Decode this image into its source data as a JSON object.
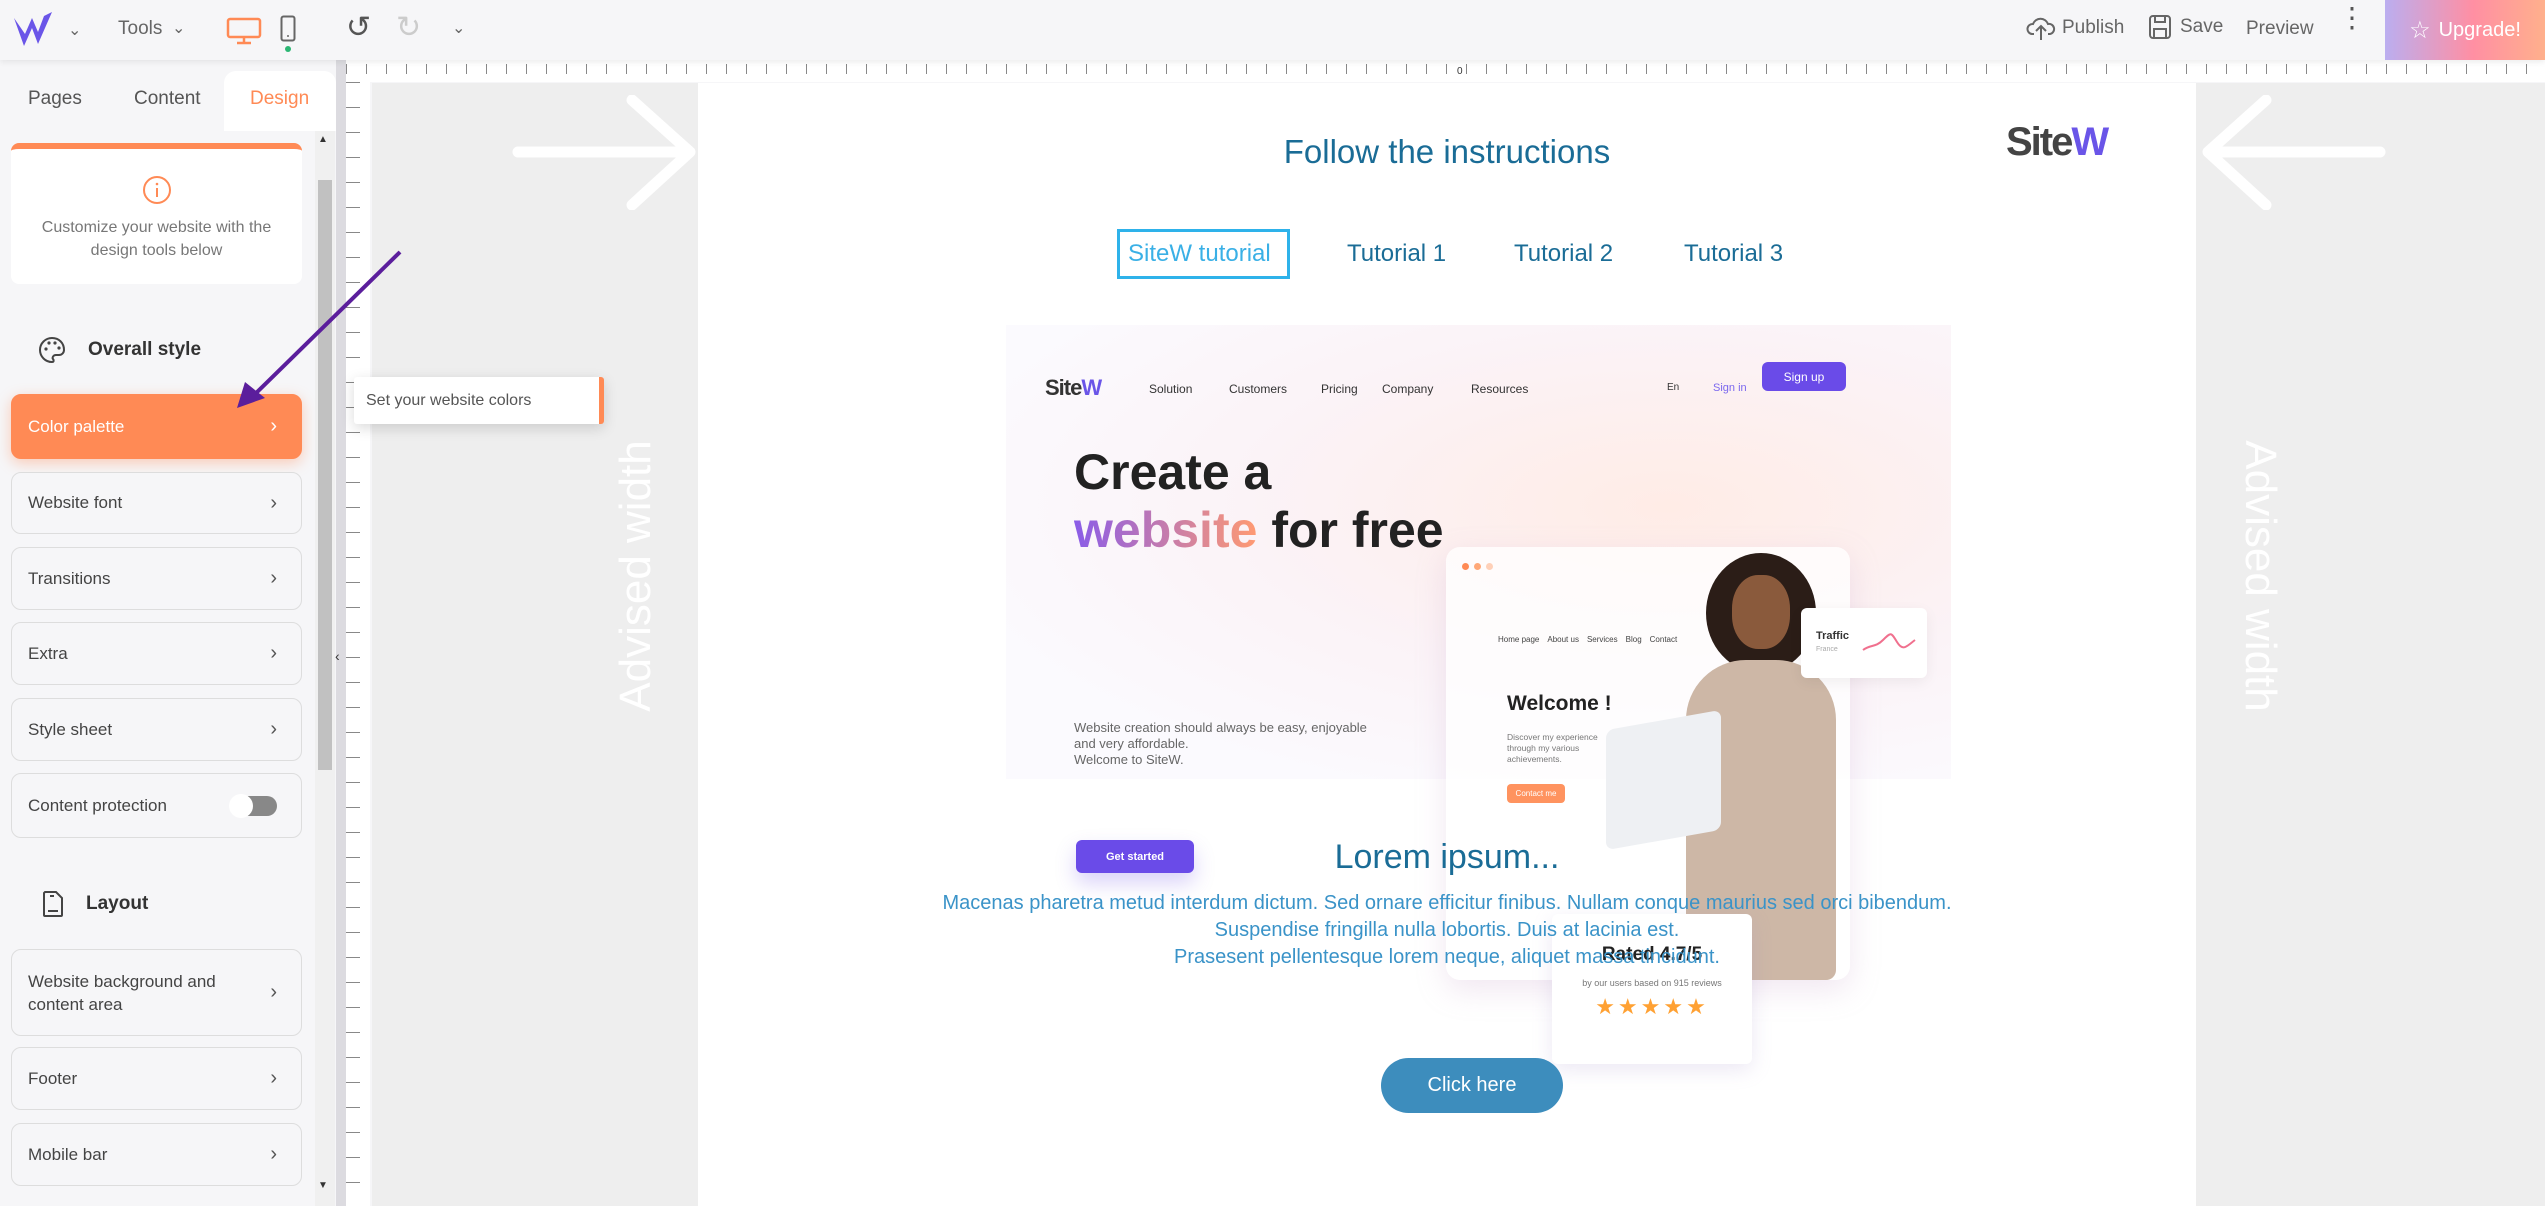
{
  "topbar": {
    "tools_label": "Tools",
    "publish_label": "Publish",
    "save_label": "Save",
    "preview_label": "Preview",
    "upgrade_label": "Upgrade!",
    "accent": "#ff8a55",
    "upgrade_gradient": [
      "#bbaef0",
      "#ff8fa3",
      "#ffb08c"
    ]
  },
  "sidebar": {
    "tabs": [
      {
        "label": "Pages"
      },
      {
        "label": "Content"
      },
      {
        "label": "Design",
        "active": true
      }
    ],
    "info_text": "Customize your website with the design tools below",
    "overall_style_title": "Overall style",
    "overall_items": [
      {
        "label": "Color palette",
        "active": true
      },
      {
        "label": "Website font"
      },
      {
        "label": "Transitions"
      },
      {
        "label": "Extra"
      },
      {
        "label": "Style sheet"
      },
      {
        "label": "Content protection",
        "toggle": false
      }
    ],
    "layout_title": "Layout",
    "layout_items": [
      {
        "label": "Website background and content area"
      },
      {
        "label": "Footer"
      },
      {
        "label": "Mobile bar"
      }
    ]
  },
  "tooltip": {
    "text": "Set your website colors"
  },
  "canvas": {
    "advised_width_label": "Advised width",
    "ruler_zero": "0"
  },
  "page": {
    "title": "Follow the instructions",
    "logo": "SiteW",
    "tabs": [
      {
        "label": "SiteW tutorial",
        "active": true
      },
      {
        "label": "Tutorial 1"
      },
      {
        "label": "Tutorial 2"
      },
      {
        "label": "Tutorial 3"
      }
    ],
    "hero": {
      "logo": "SiteW",
      "nav": [
        "Solution",
        "Customers",
        "Pricing",
        "Company",
        "Resources"
      ],
      "lang": "En",
      "signin": "Sign in",
      "signup": "Sign up",
      "headline_1": "Create a",
      "headline_2a": "website",
      "headline_2b": "for free",
      "sub_lines": [
        "Website creation should always be easy, enjoyable",
        "and very affordable.",
        "Welcome to SiteW."
      ],
      "cta": "Get started",
      "mock_nav": [
        "Home page",
        "About us",
        "Services",
        "Blog",
        "Contact"
      ],
      "mock_welcome": "Welcome !",
      "mock_text_lines": [
        "Discover my experience",
        "through my various",
        "achievements."
      ],
      "mock_button": "Contact me",
      "traffic_title": "Traffic",
      "traffic_sub": "France",
      "rating_title": "Rated 4.7/5",
      "rating_sub": "by our users based on 915 reviews",
      "rating_stars": 5
    },
    "section_title": "Lorem ipsum...",
    "paragraph_lines": [
      "Macenas pharetra metud interdum dictum. Sed ornare efficitur finibus. Nullam conque maurius sed orci bibendum.",
      "Suspendise fringilla nulla lobortis. Duis at lacinia est.",
      "Prasesent pellentesque lorem neque, aliquet massa tincidunt."
    ],
    "button_label": "Click here"
  }
}
